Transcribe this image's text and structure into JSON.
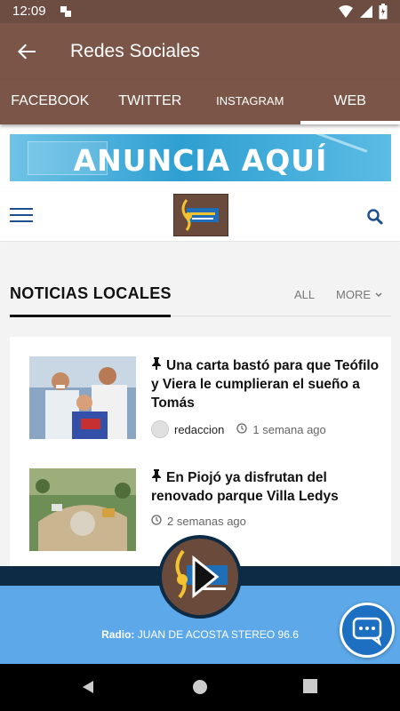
{
  "status_bar": {
    "time": "12:09"
  },
  "app_bar": {
    "title": "Redes Sociales"
  },
  "tabs": [
    {
      "label": "FACEBOOK",
      "active": false
    },
    {
      "label": "TWITTER",
      "active": false
    },
    {
      "label": "INSTAGRAM",
      "active": false
    },
    {
      "label": "WEB",
      "active": true
    }
  ],
  "banner": {
    "text": "ANUNCIA AQUÍ"
  },
  "section": {
    "title": "NOTICIAS LOCALES",
    "all_label": "ALL",
    "more_label": "MORE"
  },
  "articles": [
    {
      "title": "Una carta bastó para que Teófilo y Viera le cumplieran el sueño a Tomás",
      "author": "redaccion",
      "time": "1 semana ago"
    },
    {
      "title": "En Piojó ya disfrutan del renovado parque Villa Ledys",
      "time": "2 semanas ago"
    }
  ],
  "player": {
    "radio_prefix": "Radio:",
    "station": "JUAN DE ACOSTA STEREO 96.6"
  },
  "colors": {
    "appbar": "#7b5648",
    "statusbar": "#6d4c41",
    "accent_blue": "#1f4f8f",
    "player_blue": "#5ca8e8",
    "player_dark": "#0d2b45",
    "chat_fab": "#1d6fc2"
  },
  "icons": {
    "back": "arrow-left-icon",
    "menu": "hamburger-menu-icon",
    "search": "search-icon",
    "pin": "pushpin-icon",
    "clock": "clock-icon",
    "play": "play-icon",
    "chat": "chat-bubble-icon"
  }
}
